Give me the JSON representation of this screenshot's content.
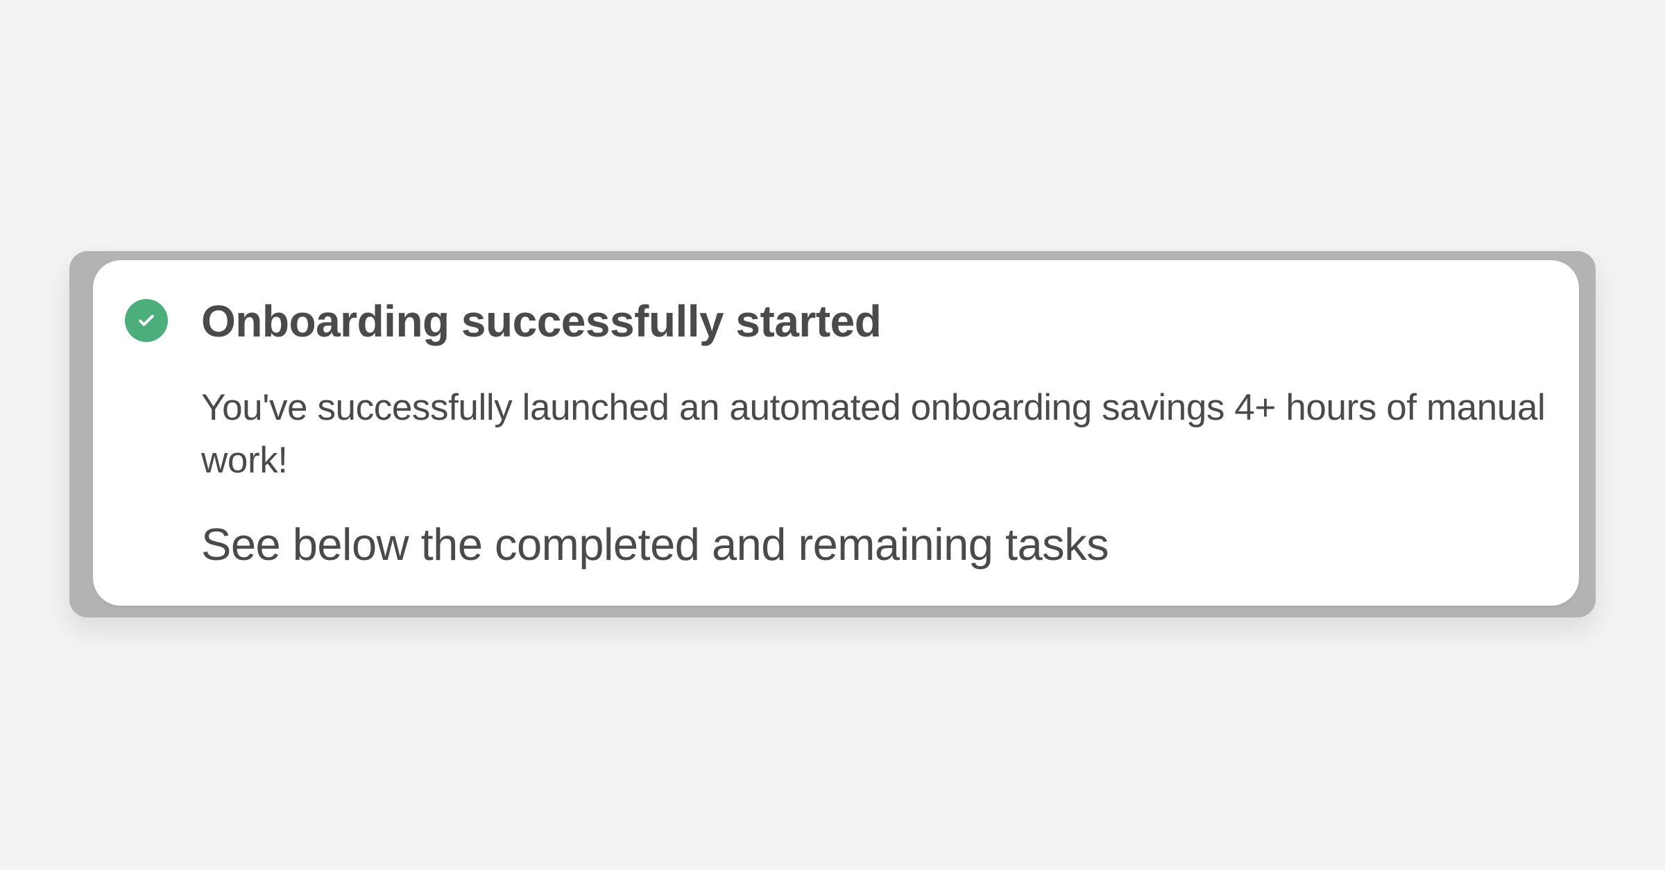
{
  "toast": {
    "status": "success",
    "icon": "check-circle-icon",
    "accent_color": "#4cae7a",
    "title": "Onboarding successfully started",
    "message": "You've successfully launched an automated onboarding savings 4+ hours of manual work!",
    "footer": "See below the completed and remaining tasks"
  }
}
